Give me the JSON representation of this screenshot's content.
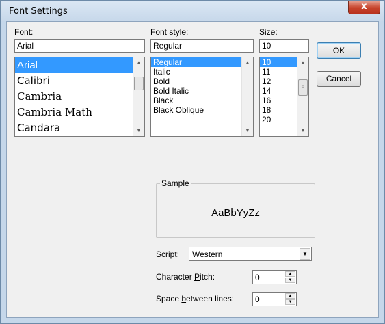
{
  "window": {
    "title": "Font Settings",
    "close_label": "x"
  },
  "font": {
    "label_prefix": "",
    "label_mnemonic": "F",
    "label_rest": "ont:",
    "value": "Arial",
    "items": [
      "Arial",
      "Calibri",
      "Cambria",
      "Cambria Math",
      "Candara"
    ],
    "selected": "Arial"
  },
  "font_style": {
    "label_prefix": "Font st",
    "label_mnemonic": "y",
    "label_rest": "le:",
    "value": "Regular",
    "items": [
      "Regular",
      "Italic",
      "Bold",
      "Bold Italic",
      "Black",
      "Black Oblique"
    ],
    "selected": "Regular"
  },
  "size": {
    "label_prefix": "",
    "label_mnemonic": "S",
    "label_rest": "ize:",
    "value": "10",
    "items": [
      "10",
      "11",
      "12",
      "14",
      "16",
      "18",
      "20"
    ],
    "selected": "10"
  },
  "buttons": {
    "ok": "OK",
    "cancel": "Cancel"
  },
  "sample": {
    "label": "Sample",
    "text": "AaBbYyZz"
  },
  "script": {
    "label_prefix": "Sc",
    "label_mnemonic": "r",
    "label_rest": "ipt:",
    "value": "Western"
  },
  "character_pitch": {
    "label_prefix": "Character ",
    "label_mnemonic": "P",
    "label_rest": "itch:",
    "value": "0"
  },
  "line_spacing": {
    "label_prefix": "Space ",
    "label_mnemonic": "b",
    "label_rest": "etween lines:",
    "value": "0"
  },
  "colors": {
    "selection": "#3399ff",
    "close_button": "#c7432b",
    "frame": "#c5d7ea"
  }
}
